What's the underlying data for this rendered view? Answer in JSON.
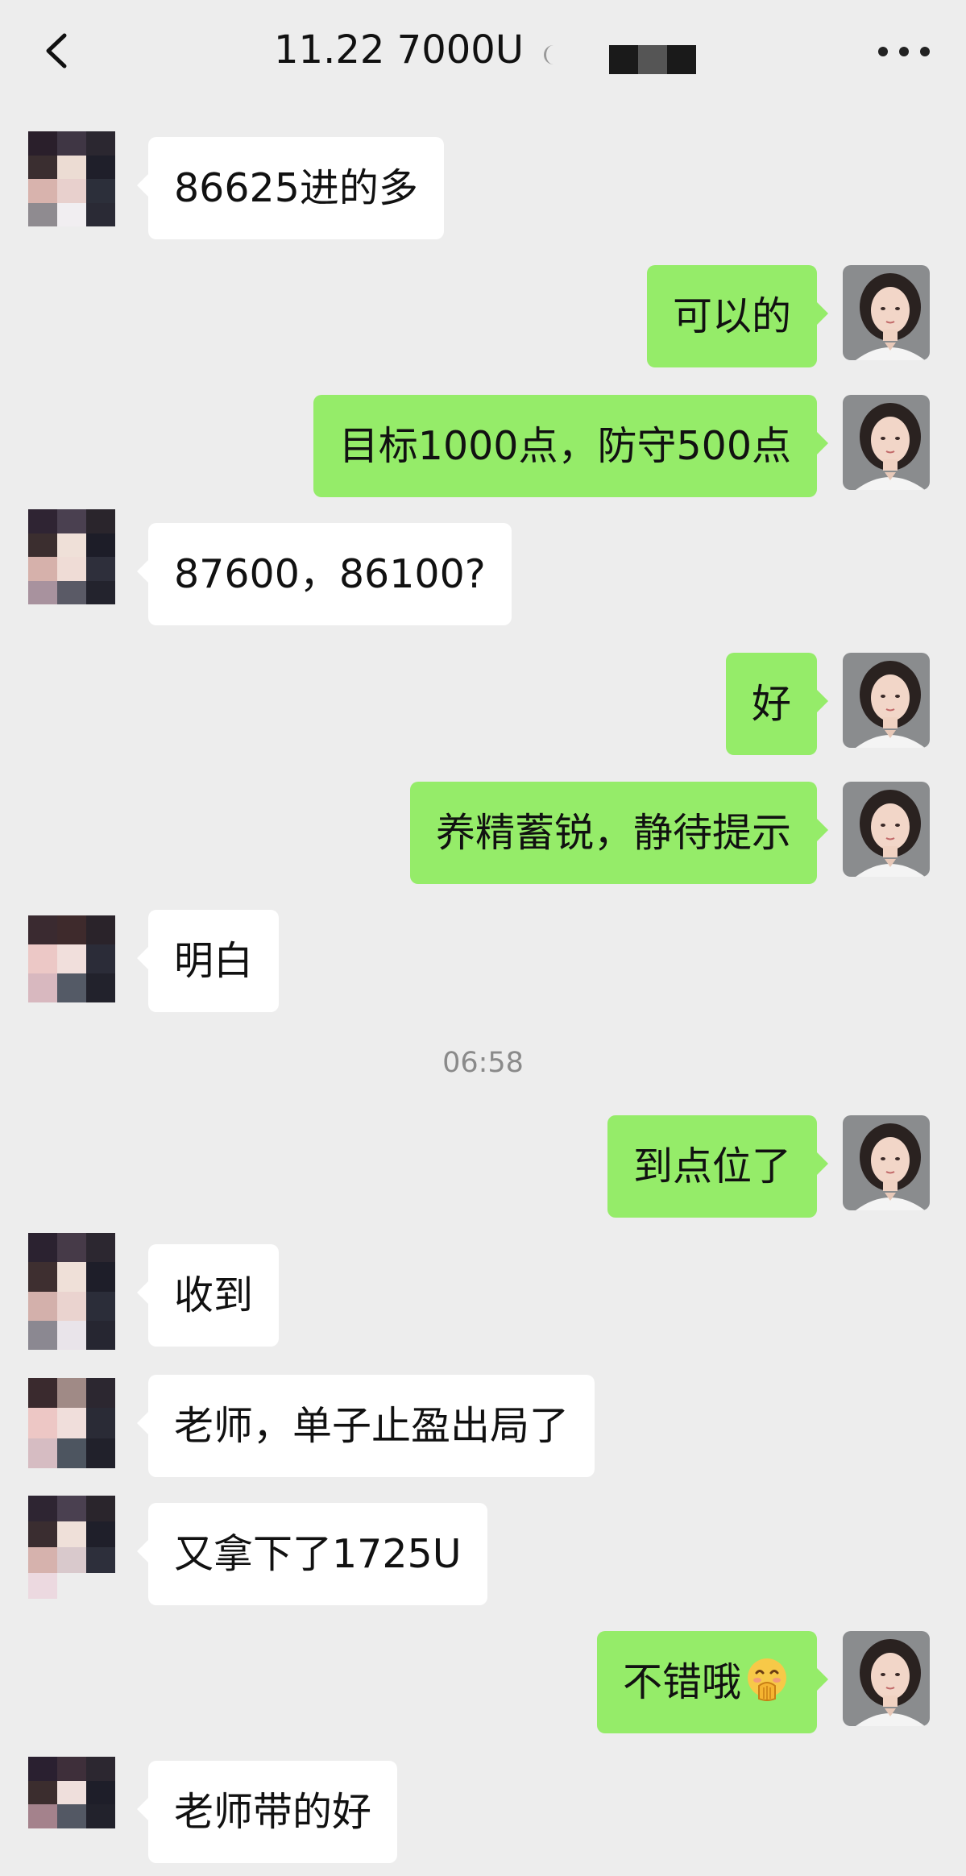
{
  "header": {
    "title": "11.22  7000U"
  },
  "timestamp": "06:58",
  "messages": [
    {
      "side": "left",
      "text": "86625进的多"
    },
    {
      "side": "right",
      "text": "可以的"
    },
    {
      "side": "right",
      "text": "目标1000点，防守500点"
    },
    {
      "side": "left",
      "text": "87600，86100?"
    },
    {
      "side": "right",
      "text": "好"
    },
    {
      "side": "right",
      "text": "养精蓄锐，静待提示"
    },
    {
      "side": "left",
      "text": "明白"
    },
    {
      "side": "right",
      "text": "到点位了"
    },
    {
      "side": "left",
      "text": "收到"
    },
    {
      "side": "left",
      "text": "老师，单子止盈出局了"
    },
    {
      "side": "left",
      "text": "又拿下了1725U"
    },
    {
      "side": "right",
      "text": "不错哦",
      "emoji": "hand-over-mouth-emoji"
    },
    {
      "side": "left",
      "text": "老师带的好"
    }
  ],
  "colors": {
    "background": "#ededed",
    "bubble_self": "#95ec69",
    "bubble_other": "#ffffff",
    "timestamp": "#8a8a8a"
  },
  "icons": {
    "back": "chevron-left-icon",
    "more": "more-horizontal-icon"
  }
}
